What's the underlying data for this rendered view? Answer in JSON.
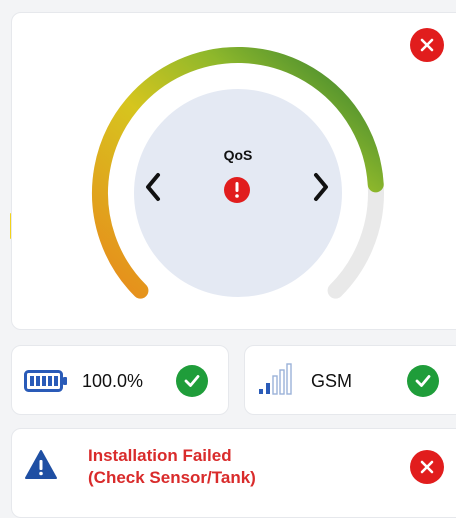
{
  "gauge": {
    "label": "QoS",
    "status_icon": "error-exclamation-icon",
    "prev_icon": "chevron-left-icon",
    "next_icon": "chevron-right-icon",
    "close_icon": "close-x-icon",
    "colors": {
      "arc_start": "#e88a1c",
      "arc_mid": "#d6c51e",
      "arc_end": "#2e7d32",
      "track": "#e9e9e9",
      "inner_circle": "#e4e9f3",
      "error": "#e11d1d"
    },
    "fill_fraction": 0.82
  },
  "battery": {
    "icon": "battery-full-icon",
    "value": "100.0%",
    "status_icon": "check-icon",
    "icon_color": "#2a5bb8"
  },
  "signal": {
    "icon": "signal-bars-icon",
    "label": "GSM",
    "status_icon": "check-icon",
    "icon_color": "#2a5bb8"
  },
  "alert": {
    "icon": "warning-triangle-icon",
    "message": "Installation Failed\n(Check Sensor/Tank)",
    "status_icon": "close-x-icon",
    "text_color": "#d92b2b"
  }
}
